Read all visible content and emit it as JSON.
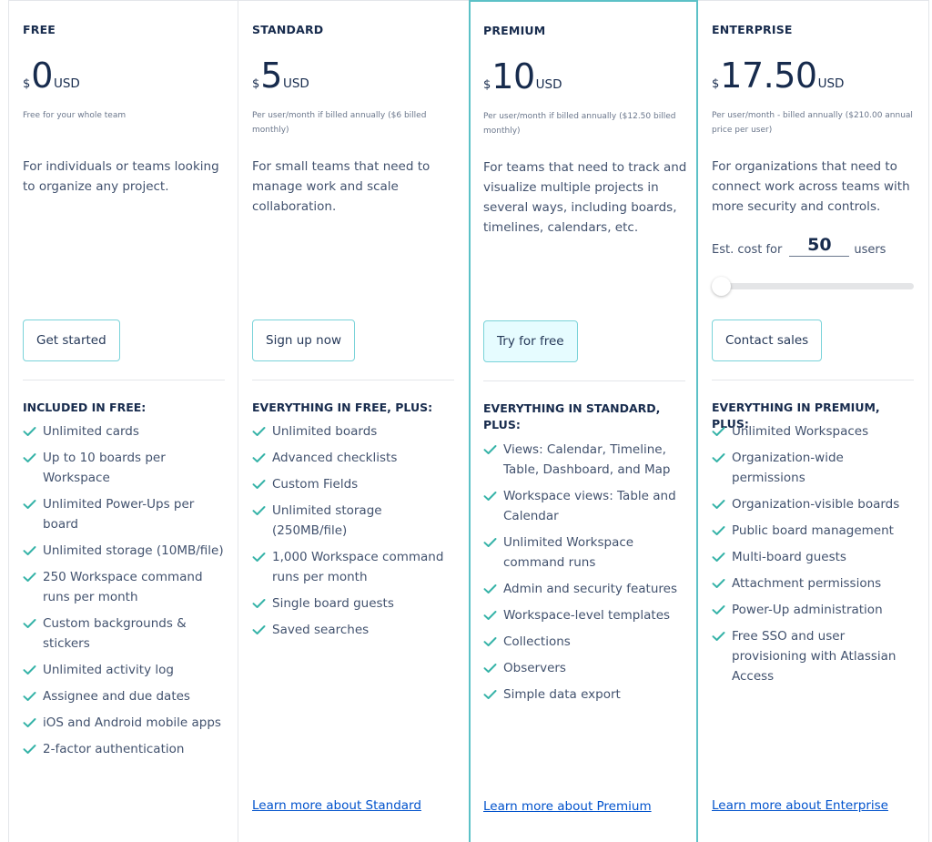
{
  "colors": {
    "accent": "#5cc1c7",
    "check": "#36b3a8",
    "link": "#0052cc",
    "heading": "#172b4d",
    "body": "#42526e"
  },
  "plans": [
    {
      "name": "FREE",
      "currency": "$",
      "price": "0",
      "unit": "USD",
      "note": "Free for your whole team",
      "description": "For individuals or teams looking to organize any project.",
      "button": "Get started",
      "features_title": "INCLUDED IN FREE:",
      "features": [
        "Unlimited cards",
        "Up to 10 boards per Workspace",
        "Unlimited Power-Ups per board",
        "Unlimited storage (10MB/file)",
        "250 Workspace command runs per month",
        "Custom backgrounds & stickers",
        "Unlimited activity log",
        "Assignee and due dates",
        "iOS and Android mobile apps",
        "2-factor authentication"
      ]
    },
    {
      "name": "STANDARD",
      "currency": "$",
      "price": "5",
      "unit": "USD",
      "note": "Per user/month if billed annually ($6 billed monthly)",
      "description": "For small teams that need to manage work and scale collaboration.",
      "button": "Sign up now",
      "features_title": "EVERYTHING IN FREE, PLUS:",
      "features": [
        "Unlimited boards",
        "Advanced checklists",
        "Custom Fields",
        "Unlimited storage (250MB/file)",
        "1,000 Workspace command runs per month",
        "Single board guests",
        "Saved searches"
      ],
      "learn_more": "Learn more about Standard"
    },
    {
      "name": "PREMIUM",
      "currency": "$",
      "price": "10",
      "unit": "USD",
      "note": "Per user/month if billed annually ($12.50 billed monthly)",
      "description": "For teams that need to track and visualize multiple projects in several ways, including boards, timelines, calendars, etc.",
      "button": "Try for free",
      "features_title": "EVERYTHING IN STANDARD, PLUS:",
      "features": [
        "Views: Calendar, Timeline, Table, Dashboard, and Map",
        "Workspace views: Table and Calendar",
        "Unlimited Workspace command runs",
        "Admin and security features",
        "Workspace-level templates",
        "Collections",
        "Observers",
        "Simple data export"
      ],
      "learn_more": "Learn more about Premium"
    },
    {
      "name": "ENTERPRISE",
      "currency": "$",
      "price": "17.50",
      "unit": "USD",
      "note": "Per user/month - billed annually ($210.00 annual price per user)",
      "description": "For organizations that need to connect work across teams with more security and controls.",
      "estimator": {
        "prefix": "Est. cost for",
        "users": "50",
        "suffix": "users",
        "slider_fraction": 0.0
      },
      "button": "Contact sales",
      "features_title": "EVERYTHING IN PREMIUM, PLUS:",
      "features": [
        "Unlimited Workspaces",
        "Organization-wide permissions",
        "Organization-visible boards",
        "Public board management",
        "Multi-board guests",
        "Attachment permissions",
        "Power-Up administration",
        "Free SSO and user provisioning with Atlassian Access"
      ],
      "learn_more": "Learn more about Enterprise"
    }
  ]
}
